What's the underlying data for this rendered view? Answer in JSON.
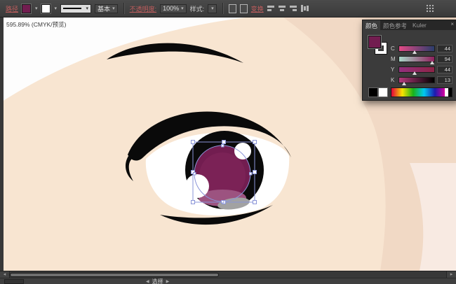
{
  "toolbar": {
    "object_label": "路径",
    "brush_label": "基本",
    "opacity_label": "不透明度:",
    "opacity_value": "100%",
    "style_label": "样式:",
    "transform_label": "变换"
  },
  "document": {
    "title": "595.89% (CMYK/预览)"
  },
  "glyphs": {
    "dropdown": "▾",
    "close": "×",
    "scroll_left": "◂",
    "scroll_right": "▸",
    "nav_left": "◀",
    "nav_right": "▶"
  },
  "color_panel": {
    "tabs": [
      {
        "label": "颜色"
      },
      {
        "label": "颜色参考"
      },
      {
        "label": "Kuler"
      }
    ],
    "fill_color": "#721d50",
    "stroke_color": "#ffffff",
    "sliders": [
      {
        "label": "C",
        "value": "44",
        "percent": 44
      },
      {
        "label": "M",
        "value": "94",
        "percent": 94
      },
      {
        "label": "Y",
        "value": "44",
        "percent": 44
      },
      {
        "label": "K",
        "value": "13",
        "percent": 13
      }
    ]
  },
  "status_bar": {
    "tool_label": "选择"
  },
  "canvas_colors": {
    "skin": "#f8e5d1",
    "skin_shade": "#f1d9c5",
    "skin_pink": "#f8eae2",
    "line_black": "#0a0a0a",
    "sclera": "#ffffff",
    "iris_magenta": "#721d50",
    "iris_inner": "#7b2256",
    "iris_crescent": "#9c5380",
    "highlight_gray": "#a2a2a2",
    "selection_blue": "#8a94d8"
  }
}
